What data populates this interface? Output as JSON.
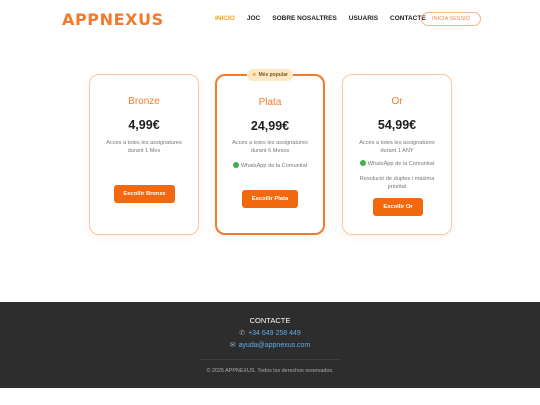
{
  "header": {
    "logo": "APPNEXUS",
    "nav": [
      "INICIO",
      "JOC",
      "SOBRE NOSALTRES",
      "USUARIS",
      "CONTACTE"
    ],
    "login": "INICIA SESSIÓ"
  },
  "plans": [
    {
      "name": "Bronze",
      "price": "4,99€",
      "access": "Acces a totes les assignatures durant 1 Mes",
      "button": "Escollir Bronze"
    },
    {
      "badge": "Més popular",
      "name": "Plata",
      "price": "24,99€",
      "access": "Acces a totes les assignatures durant 6 Mesos",
      "whatsapp": "WhatsApp de la Comunitat",
      "button": "Escollir Plata"
    },
    {
      "name": "Or",
      "price": "54,99€",
      "access": "Acces a totes les assignatures durant 1 ANY",
      "whatsapp": "WhatsApp de la Comunitat",
      "doubts": "Resolució de duptes i maxima prioritat",
      "button": "Escollir Or"
    }
  ],
  "footer": {
    "title": "CONTACTE",
    "phone": "+34 649 258 449",
    "email": "ayuda@appnexus.com",
    "copyright": "© 2025 APPNEXUS. Todos los derechos reservados."
  },
  "colors": {
    "accent": "#f07c2c",
    "button": "#f2680f",
    "active_nav": "#f4a21d",
    "footer_bg": "#2d2d2d",
    "link": "#5aaee8"
  },
  "icons": {
    "whatsapp": "green-dot-icon",
    "phone": "phone-icon",
    "email": "email-icon",
    "badge": "star-icon"
  }
}
